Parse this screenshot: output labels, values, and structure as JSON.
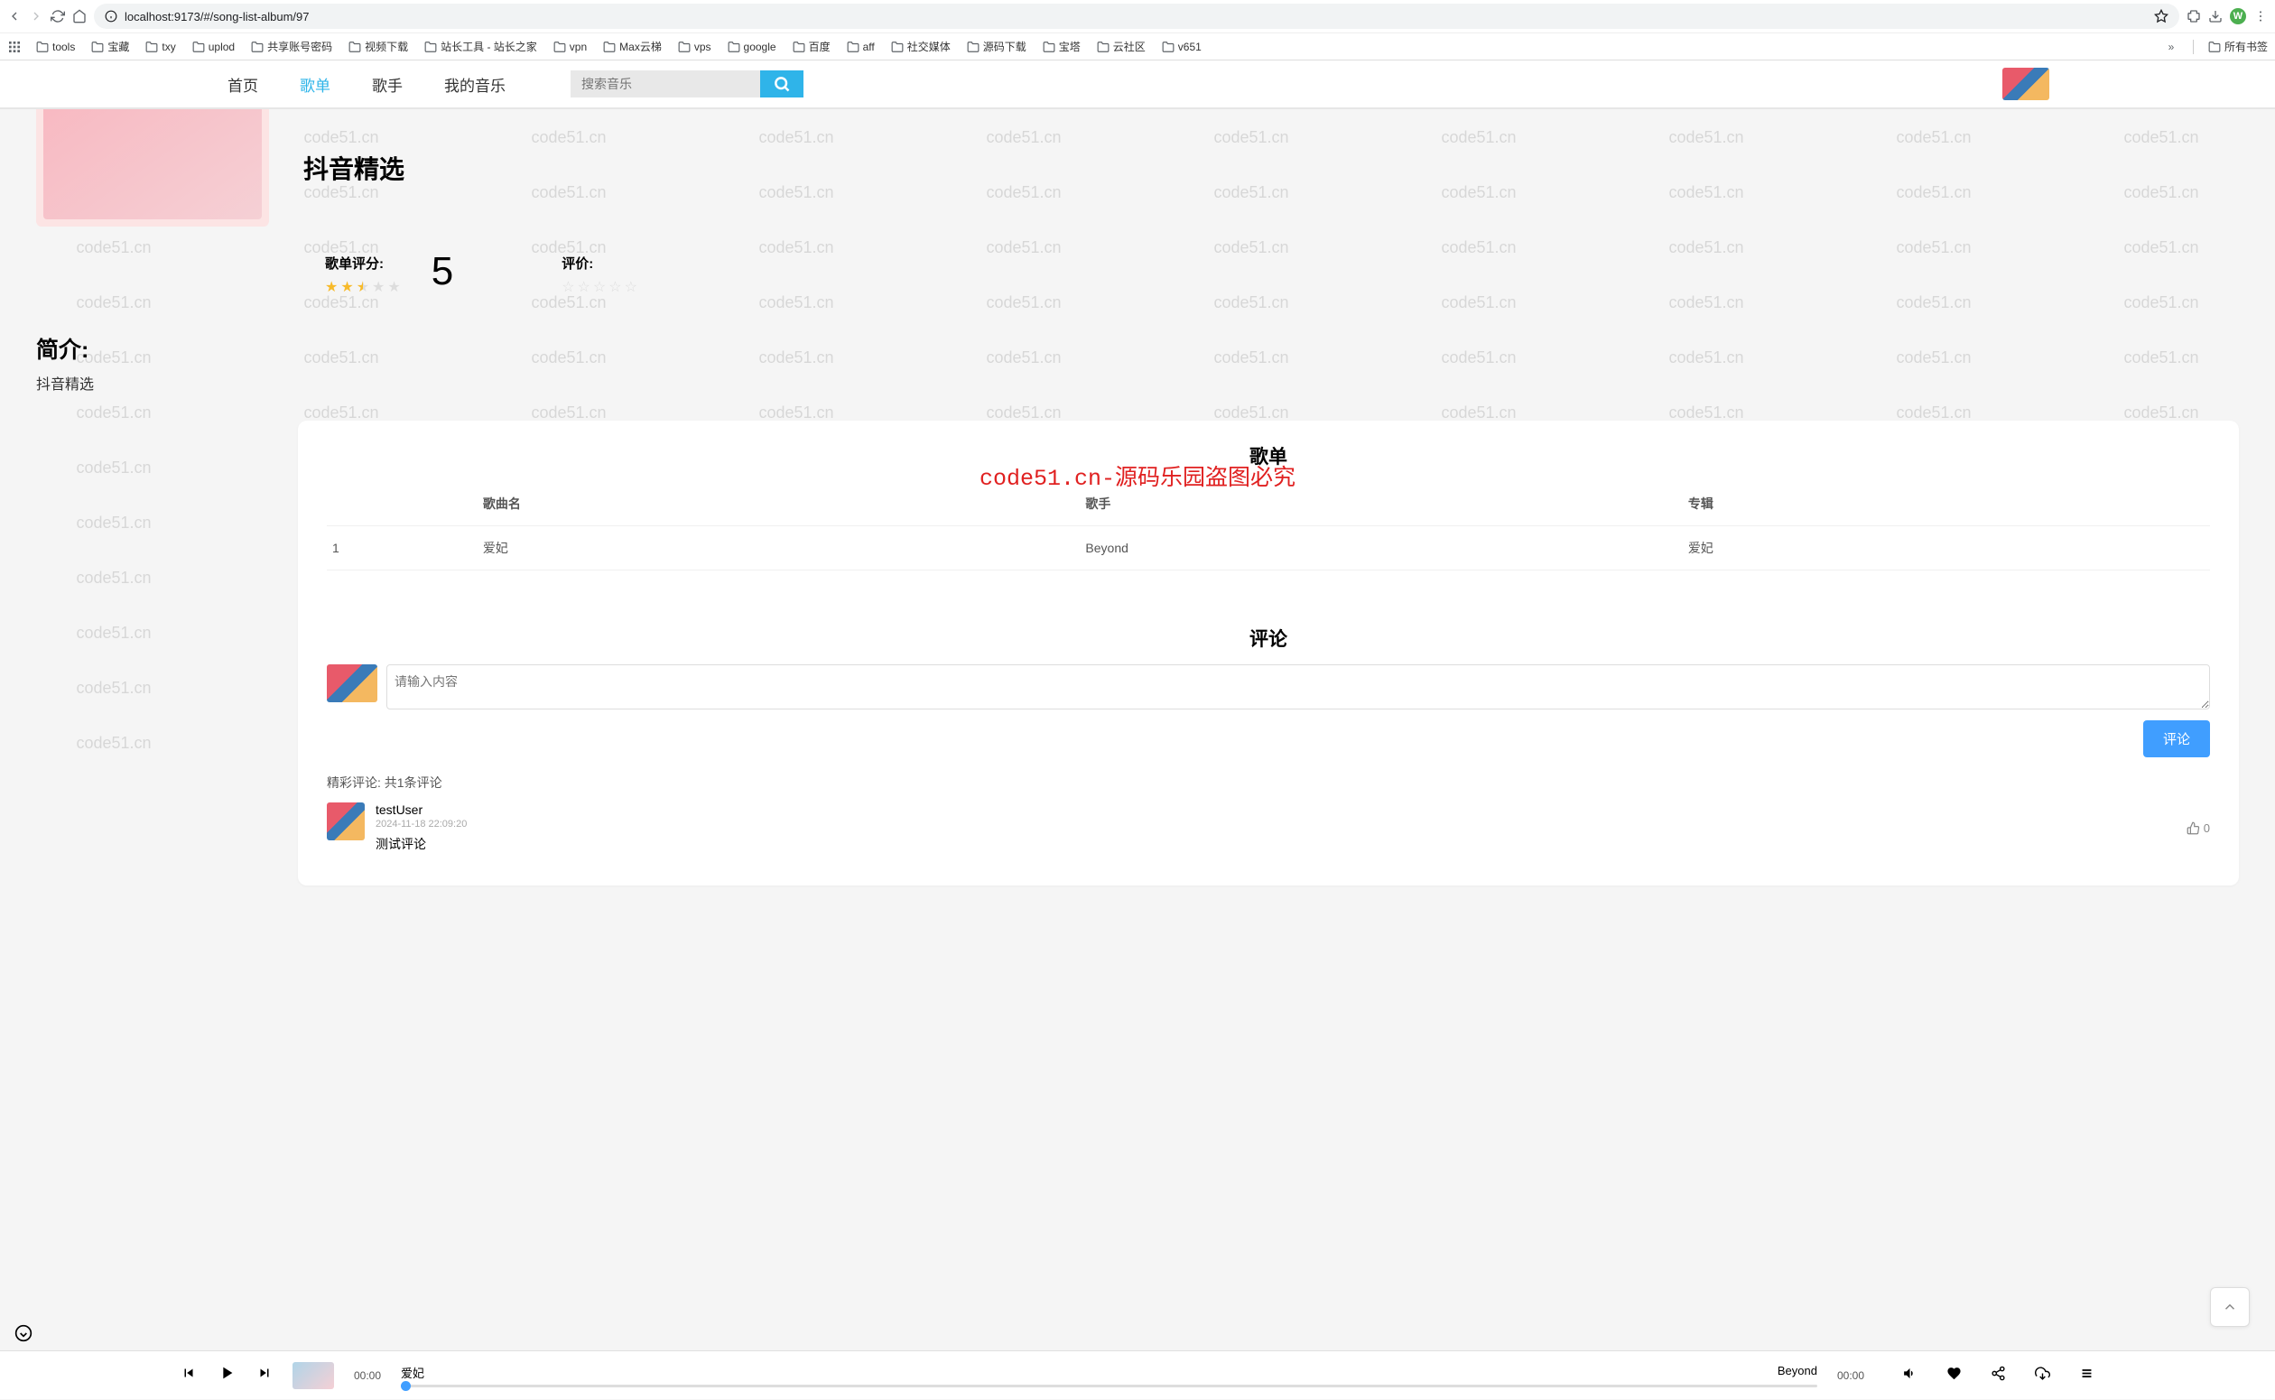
{
  "browser": {
    "url": "localhost:9173/#/song-list-album/97",
    "avatar_letter": "W",
    "bookmarks": [
      "tools",
      "宝藏",
      "txy",
      "uplod",
      "共享账号密码",
      "视频下载",
      "站长工具 - 站长之家",
      "vpn",
      "Max云梯",
      "vps",
      "google",
      "百度",
      "aff",
      "社交媒体",
      "源码下载",
      "宝塔",
      "云社区",
      "v651"
    ],
    "all_bookmarks": "所有书签"
  },
  "nav": {
    "items": [
      "首页",
      "歌单",
      "歌手",
      "我的音乐"
    ],
    "search_placeholder": "搜索音乐"
  },
  "album": {
    "title": "抖音精选",
    "rating_label": "歌单评分:",
    "rating_score": "5",
    "eval_label": "评价:"
  },
  "intro": {
    "title": "简介:",
    "text": "抖音精选"
  },
  "songlist": {
    "title": "歌单",
    "cols": {
      "name": "歌曲名",
      "singer": "歌手",
      "album": "专辑"
    },
    "rows": [
      {
        "idx": "1",
        "name": "爱妃",
        "singer": "Beyond",
        "album": "爱妃"
      }
    ]
  },
  "overlay_text": "code51.cn-源码乐园盗图必究",
  "comments": {
    "title": "评论",
    "placeholder": "请输入内容",
    "submit": "评论",
    "count_label": "精彩评论: 共1条评论",
    "items": [
      {
        "user": "testUser",
        "time": "2024-11-18 22:09:20",
        "text": "测试评论",
        "likes": "0"
      }
    ]
  },
  "player": {
    "track": "爱妃",
    "artist": "Beyond",
    "time_cur": "00:00",
    "time_end": "00:00"
  },
  "watermark": "code51.cn"
}
